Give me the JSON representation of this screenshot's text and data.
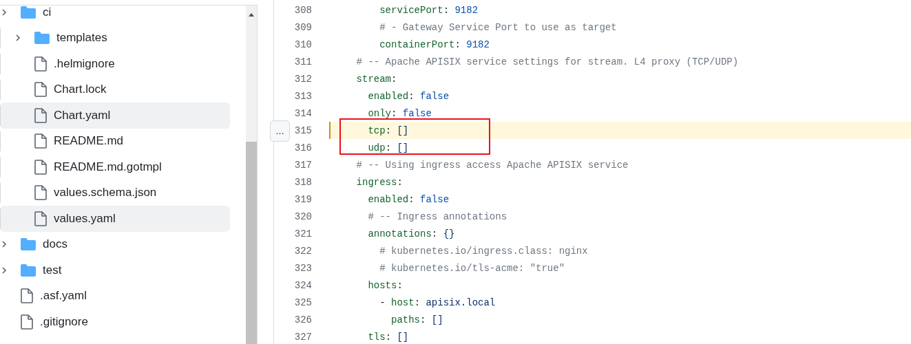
{
  "file_tree": [
    {
      "kind": "folder",
      "name": "ci",
      "expanded": false,
      "selected": false,
      "nested": false
    },
    {
      "kind": "folder",
      "name": "templates",
      "expanded": false,
      "selected": false,
      "nested": true
    },
    {
      "kind": "file",
      "name": ".helmignore",
      "selected": false,
      "nested": true
    },
    {
      "kind": "file",
      "name": "Chart.lock",
      "selected": false,
      "nested": true
    },
    {
      "kind": "file",
      "name": "Chart.yaml",
      "selected": true,
      "nested": true
    },
    {
      "kind": "file",
      "name": "README.md",
      "selected": false,
      "nested": true
    },
    {
      "kind": "file",
      "name": "README.md.gotmpl",
      "selected": false,
      "nested": true
    },
    {
      "kind": "file",
      "name": "values.schema.json",
      "selected": false,
      "nested": true
    },
    {
      "kind": "file",
      "name": "values.yaml",
      "selected": true,
      "nested": true
    },
    {
      "kind": "folder",
      "name": "docs",
      "expanded": false,
      "selected": false,
      "nested": false
    },
    {
      "kind": "folder",
      "name": "test",
      "expanded": false,
      "selected": false,
      "nested": false
    },
    {
      "kind": "file",
      "name": ".asf.yaml",
      "selected": false,
      "nested": false
    },
    {
      "kind": "file",
      "name": ".gitignore",
      "selected": false,
      "nested": false
    }
  ],
  "code": {
    "expand_button": "…",
    "lines": [
      {
        "number": "308",
        "highlighted": false,
        "segments": [
          {
            "kind": "key",
            "text": "        servicePort"
          },
          {
            "kind": "punct",
            "text": ": "
          },
          {
            "kind": "value",
            "text": "9182"
          }
        ]
      },
      {
        "number": "309",
        "highlighted": false,
        "segments": [
          {
            "kind": "comment",
            "text": "        # - Gateway Service Port to use as target"
          }
        ]
      },
      {
        "number": "310",
        "highlighted": false,
        "segments": [
          {
            "kind": "key",
            "text": "        containerPort"
          },
          {
            "kind": "punct",
            "text": ": "
          },
          {
            "kind": "value",
            "text": "9182"
          }
        ]
      },
      {
        "number": "311",
        "highlighted": false,
        "segments": [
          {
            "kind": "comment",
            "text": "    # -- Apache APISIX service settings for stream. L4 proxy (TCP/UDP)"
          }
        ]
      },
      {
        "number": "312",
        "highlighted": false,
        "segments": [
          {
            "kind": "key",
            "text": "    stream"
          },
          {
            "kind": "punct",
            "text": ":"
          }
        ]
      },
      {
        "number": "313",
        "highlighted": false,
        "segments": [
          {
            "kind": "key",
            "text": "      enabled"
          },
          {
            "kind": "punct",
            "text": ": "
          },
          {
            "kind": "value",
            "text": "false"
          }
        ]
      },
      {
        "number": "314",
        "highlighted": false,
        "segments": [
          {
            "kind": "key",
            "text": "      only"
          },
          {
            "kind": "punct",
            "text": ": "
          },
          {
            "kind": "value",
            "text": "false"
          }
        ]
      },
      {
        "number": "315",
        "highlighted": true,
        "segments": [
          {
            "kind": "key",
            "text": "      tcp"
          },
          {
            "kind": "punct",
            "text": ": "
          },
          {
            "kind": "string",
            "text": "[]"
          }
        ]
      },
      {
        "number": "316",
        "highlighted": false,
        "segments": [
          {
            "kind": "key",
            "text": "      udp"
          },
          {
            "kind": "punct",
            "text": ": "
          },
          {
            "kind": "string",
            "text": "[]"
          }
        ]
      },
      {
        "number": "317",
        "highlighted": false,
        "segments": [
          {
            "kind": "comment",
            "text": "    # -- Using ingress access Apache APISIX service"
          }
        ]
      },
      {
        "number": "318",
        "highlighted": false,
        "segments": [
          {
            "kind": "key",
            "text": "    ingress"
          },
          {
            "kind": "punct",
            "text": ":"
          }
        ]
      },
      {
        "number": "319",
        "highlighted": false,
        "segments": [
          {
            "kind": "key",
            "text": "      enabled"
          },
          {
            "kind": "punct",
            "text": ": "
          },
          {
            "kind": "value",
            "text": "false"
          }
        ]
      },
      {
        "number": "320",
        "highlighted": false,
        "segments": [
          {
            "kind": "comment",
            "text": "      # -- Ingress annotations"
          }
        ]
      },
      {
        "number": "321",
        "highlighted": false,
        "segments": [
          {
            "kind": "key",
            "text": "      annotations"
          },
          {
            "kind": "punct",
            "text": ": "
          },
          {
            "kind": "string",
            "text": "{}"
          }
        ]
      },
      {
        "number": "322",
        "highlighted": false,
        "segments": [
          {
            "kind": "comment",
            "text": "        # kubernetes.io/ingress.class: nginx"
          }
        ]
      },
      {
        "number": "323",
        "highlighted": false,
        "segments": [
          {
            "kind": "comment",
            "text": "        # kubernetes.io/tls-acme: \"true\""
          }
        ]
      },
      {
        "number": "324",
        "highlighted": false,
        "segments": [
          {
            "kind": "key",
            "text": "      hosts"
          },
          {
            "kind": "punct",
            "text": ":"
          }
        ]
      },
      {
        "number": "325",
        "highlighted": false,
        "segments": [
          {
            "kind": "punct",
            "text": "        - "
          },
          {
            "kind": "key",
            "text": "host"
          },
          {
            "kind": "punct",
            "text": ": "
          },
          {
            "kind": "string",
            "text": "apisix.local"
          }
        ]
      },
      {
        "number": "326",
        "highlighted": false,
        "segments": [
          {
            "kind": "key",
            "text": "          paths"
          },
          {
            "kind": "punct",
            "text": ": "
          },
          {
            "kind": "string",
            "text": "[]"
          }
        ]
      },
      {
        "number": "327",
        "highlighted": false,
        "segments": [
          {
            "kind": "key",
            "text": "      tls"
          },
          {
            "kind": "punct",
            "text": ": "
          },
          {
            "kind": "string",
            "text": "[]"
          }
        ]
      }
    ]
  }
}
